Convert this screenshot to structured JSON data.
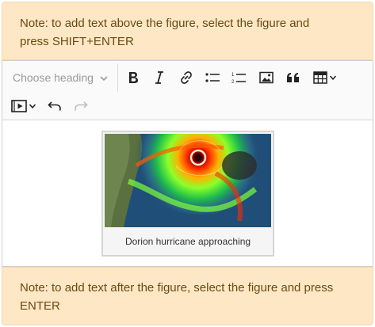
{
  "notes": {
    "top_line1": "Note: to add text above the figure, select the figure and",
    "top_line2": "press SHIFT+ENTER",
    "bottom_line1": "Note: to add text after the figure, select the figure and press",
    "bottom_line2": "ENTER"
  },
  "toolbar": {
    "heading_placeholder": "Choose heading",
    "icons": [
      "chevron-down-icon",
      "bold-icon",
      "italic-icon",
      "link-icon",
      "bulleted-list-icon",
      "numbered-list-icon",
      "image-icon",
      "blockquote-icon",
      "table-icon",
      "media-icon",
      "undo-icon",
      "redo-icon"
    ]
  },
  "figure": {
    "caption": "Dorion hurricane approaching"
  },
  "colors": {
    "note_bg": "#fde7c5",
    "note_text": "#6b4a14",
    "toolbar_bg": "#fafafa"
  }
}
